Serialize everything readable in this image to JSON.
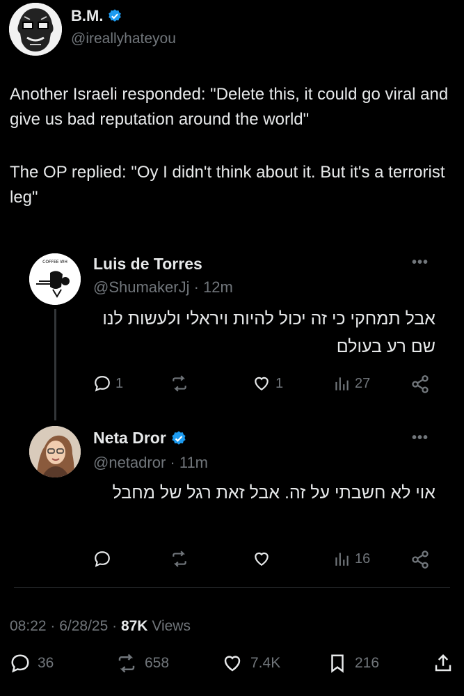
{
  "main_tweet": {
    "author_name": "B.M.",
    "author_handle": "@ireallyhateyou",
    "paragraph1": "Another Israeli responded: \"Delete this, it could go viral and give us bad reputation around the world\"",
    "paragraph2": "The OP replied: \"Oy I didn't think about it. But it's a terrorist leg\""
  },
  "quoted_replies": [
    {
      "author_name": "Luis de Torres",
      "author_handle": "@ShumakerJj",
      "time": "· 12m",
      "text": "אבל תמחקי כי זה יכול להיות ויראלי ולעשות לנו שם רע בעולם",
      "replies": "1",
      "reposts": "",
      "likes": "1",
      "views": "27"
    },
    {
      "author_name": "Neta Dror",
      "author_handle": "@netadror",
      "time": "· 11m",
      "text": "אוי לא חשבתי על זה. אבל זאת רגל של מחבל",
      "replies": "",
      "reposts": "",
      "likes": "",
      "views": "16"
    }
  ],
  "meta": {
    "time": "08:22 · 6/28/25 ·",
    "views_count": "87K",
    "views_label": "Views"
  },
  "footer": {
    "replies": "36",
    "reposts": "658",
    "likes": "7.4K",
    "bookmarks": "216"
  },
  "colors": {
    "background": "#000000",
    "text": "#e7e9ea",
    "muted": "#71767b",
    "verified": "#1d9bf0",
    "divider": "#2f3336"
  }
}
